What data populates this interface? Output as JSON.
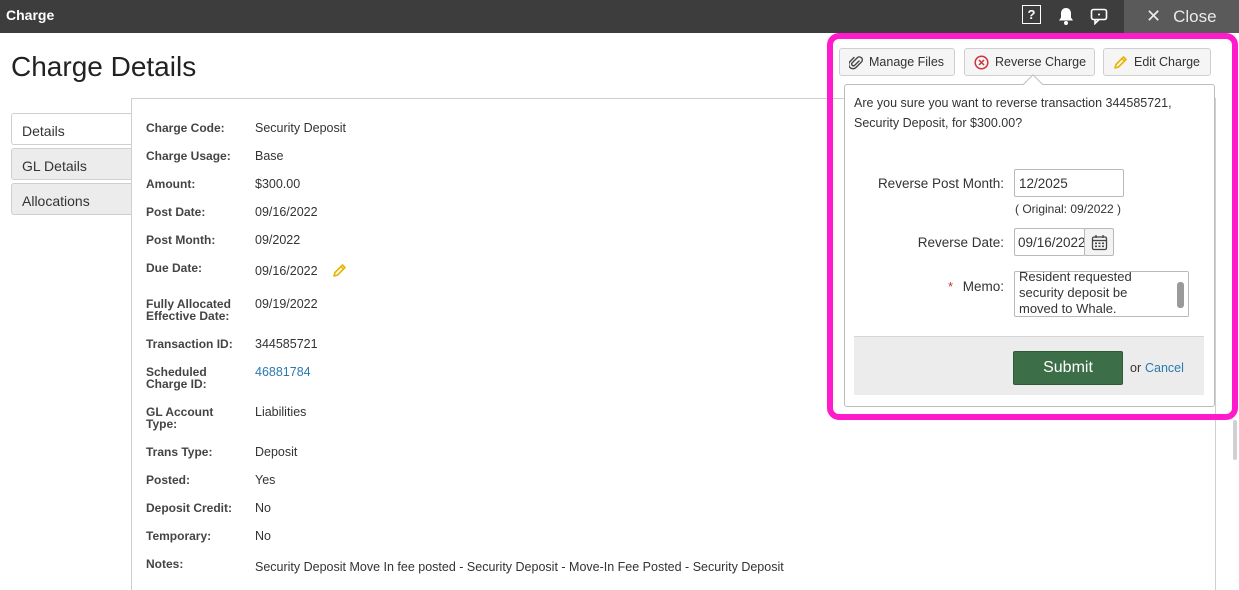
{
  "window": {
    "title": "Charge",
    "close_label": "Close",
    "help_glyph": "?"
  },
  "icons": {
    "help": "help-icon",
    "bell": "bell-icon",
    "chat": "chat-icon",
    "close": "close-icon",
    "paperclip": "paperclip-icon",
    "reverse": "circle-x-icon",
    "edit": "pencil-icon",
    "calendar": "calendar-icon"
  },
  "page": {
    "title": "Charge Details"
  },
  "tabs": [
    {
      "label": "Details",
      "active": true
    },
    {
      "label": "GL Details",
      "active": false
    },
    {
      "label": "Allocations",
      "active": false
    }
  ],
  "details": {
    "charge_code": {
      "label": "Charge Code:",
      "value": "Security Deposit"
    },
    "charge_usage": {
      "label": "Charge Usage:",
      "value": "Base"
    },
    "amount": {
      "label": "Amount:",
      "value": "$300.00"
    },
    "post_date": {
      "label": "Post Date:",
      "value": "09/16/2022"
    },
    "post_month": {
      "label": "Post Month:",
      "value": "09/2022"
    },
    "due_date": {
      "label": "Due Date:",
      "value": "09/16/2022"
    },
    "fully_allocated": {
      "label": "Fully Allocated Effective Date:",
      "value": "09/19/2022"
    },
    "transaction_id": {
      "label": "Transaction ID:",
      "value": "344585721"
    },
    "scheduled_charge_id": {
      "label": "Scheduled Charge ID:",
      "value": "46881784"
    },
    "gl_account_type": {
      "label": "GL Account Type:",
      "value": "Liabilities"
    },
    "trans_type": {
      "label": "Trans Type:",
      "value": "Deposit"
    },
    "posted": {
      "label": "Posted:",
      "value": "Yes"
    },
    "deposit_credit": {
      "label": "Deposit Credit:",
      "value": "No"
    },
    "temporary": {
      "label": "Temporary:",
      "value": "No"
    },
    "notes": {
      "label": "Notes:",
      "value": "Security Deposit Move In fee posted - Security Deposit - Move-In Fee Posted - Security Deposit"
    }
  },
  "actions": {
    "manage_files": "Manage Files",
    "reverse_charge": "Reverse Charge",
    "edit_charge": "Edit Charge"
  },
  "reverse_popup": {
    "message": "Are you sure you want to reverse transaction 344585721, Security Deposit, for $300.00?",
    "post_month_label": "Reverse Post Month:",
    "post_month_value": "12/2025",
    "original_hint": "( Original: 09/2022 )",
    "reverse_date_label": "Reverse Date:",
    "reverse_date_value": "09/16/2022",
    "required_mark": "*",
    "memo_label": "Memo:",
    "memo_value": "Resident requested security deposit be moved to Whale.",
    "submit_label": "Submit",
    "or_text": "or",
    "cancel_label": "Cancel"
  },
  "colors": {
    "topbar": "#3d3d3d",
    "highlight": "#ff1acb",
    "submit": "#3c6e47",
    "link": "#2a7ab0"
  }
}
